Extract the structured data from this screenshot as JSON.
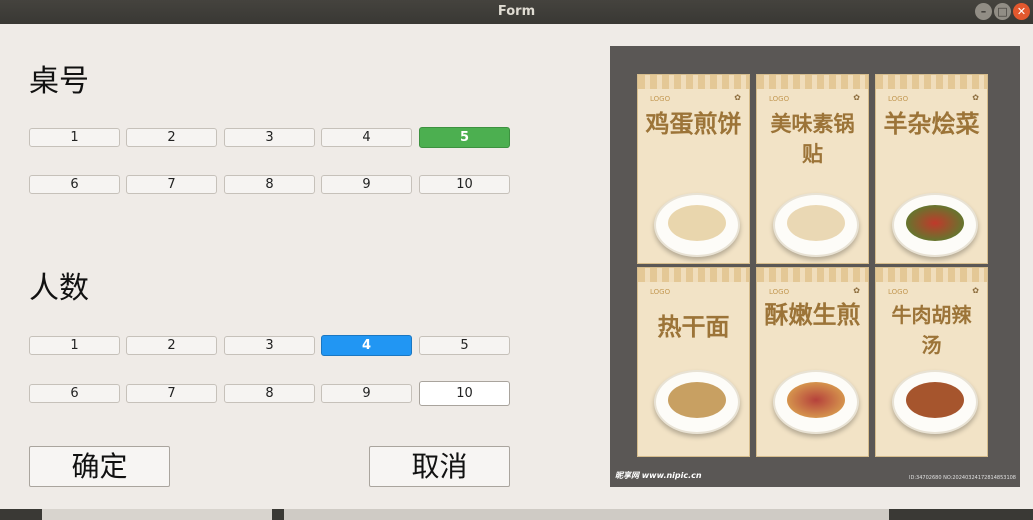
{
  "window": {
    "title": "Form"
  },
  "table_number": {
    "heading": "桌号",
    "options": [
      "1",
      "2",
      "3",
      "4",
      "5",
      "6",
      "7",
      "8",
      "9",
      "10"
    ],
    "selected": "5"
  },
  "people_count": {
    "heading": "人数",
    "options": [
      "1",
      "2",
      "3",
      "4",
      "5",
      "6",
      "7",
      "8",
      "9",
      "10"
    ],
    "selected": "4"
  },
  "buttons": {
    "confirm": "确定",
    "cancel": "取消"
  },
  "menu_image": {
    "panels": [
      {
        "logo": "LOGO",
        "title": "鸡蛋煎饼"
      },
      {
        "logo": "LOGO",
        "title": "美味素锅贴"
      },
      {
        "logo": "LOGO",
        "title": "羊杂烩菜"
      },
      {
        "logo": "LOGO",
        "title": "热干面"
      },
      {
        "logo": "LOGO",
        "title": "酥嫩生煎"
      },
      {
        "logo": "LOGO",
        "title": "牛肉胡辣汤"
      }
    ],
    "watermark": "昵享网 www.nipic.cn",
    "image_id": "ID:34702680 NO:20240324172814853108"
  },
  "colors": {
    "selected_table": "#4caf50",
    "selected_people": "#2196f3",
    "titlebar": "#3c3b37"
  }
}
